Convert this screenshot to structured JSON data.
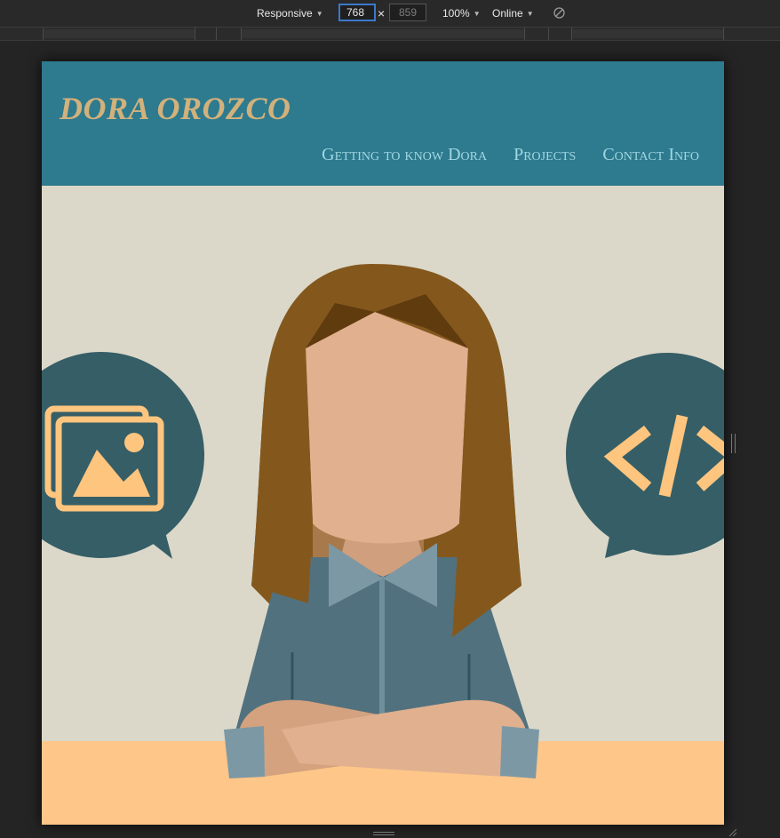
{
  "devtools": {
    "device": "Responsive",
    "width": "768",
    "height": "859",
    "zoom": "100%",
    "network": "Online"
  },
  "site": {
    "logo": "DORA OROZCO",
    "nav": [
      "Getting to know Dora",
      "Projects",
      "Contact Info"
    ]
  },
  "colors": {
    "header_bg": "#2e7a8e",
    "logo": "#d1b17c",
    "nav_link": "#9fd7e3",
    "hero_bg": "#dbd8ca",
    "desk": "#fec688",
    "bubble": "#365e66",
    "icon": "#fec57f"
  },
  "icons": [
    "image-gallery-icon",
    "code-icon",
    "screen-rotate-icon"
  ]
}
